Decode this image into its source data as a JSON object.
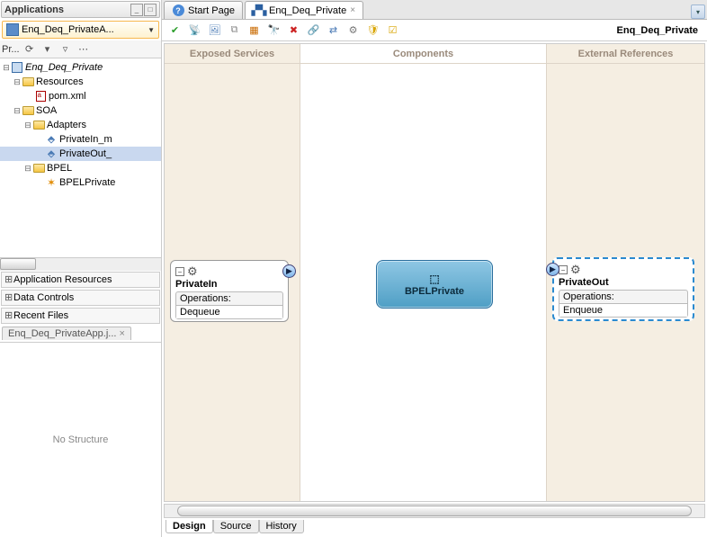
{
  "sidebar": {
    "title": "Applications",
    "combo": "Enq_Deq_PrivateA...",
    "proj_label": "Pr...",
    "tree": {
      "root": "Enq_Deq_Private",
      "resources": "Resources",
      "pom": "pom.xml",
      "soa": "SOA",
      "adapters": "Adapters",
      "adapter_in": "PrivateIn_m",
      "adapter_out": "PrivateOut_",
      "bpel_folder": "BPEL",
      "bpel_file": "BPELPrivate"
    },
    "sections": {
      "app_res": "Application Resources",
      "data_ctrl": "Data Controls",
      "recent": "Recent Files"
    },
    "bottom_tab": "Enq_Deq_PrivateApp.j...",
    "structure_msg": "No Structure"
  },
  "tabs": {
    "start": "Start Page",
    "file": "Enq_Deq_Private"
  },
  "editor": {
    "title": "Enq_Deq_Private",
    "lanes": {
      "exposed": "Exposed Services",
      "components": "Components",
      "external": "External References"
    },
    "svc_in": {
      "name": "PrivateIn",
      "ops_label": "Operations:",
      "op": "Dequeue"
    },
    "svc_out": {
      "name": "PrivateOut",
      "ops_label": "Operations:",
      "op": "Enqueue"
    },
    "bpel": "BPELPrivate",
    "bottom": {
      "design": "Design",
      "source": "Source",
      "history": "History"
    }
  }
}
